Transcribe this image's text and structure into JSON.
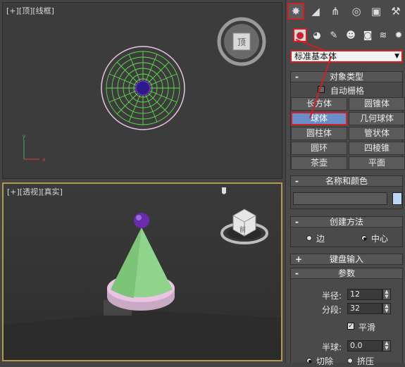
{
  "viewport_top": {
    "label": "[+][顶][线框]"
  },
  "viewport_persp": {
    "label": "[+][透视][真实]"
  },
  "viewcube_top": {
    "face": "顶"
  },
  "viewcube_persp": {
    "face": "前"
  },
  "panel": {
    "tabs": [
      {
        "icon": "create-icon",
        "glyph": "✸",
        "selected": true
      },
      {
        "icon": "modify-icon",
        "glyph": "◢",
        "selected": false
      },
      {
        "icon": "hierarchy-icon",
        "glyph": "⋔",
        "selected": false
      },
      {
        "icon": "motion-icon",
        "glyph": "◎",
        "selected": false
      },
      {
        "icon": "display-icon",
        "glyph": "▣",
        "selected": false
      },
      {
        "icon": "utilities-icon",
        "glyph": "⚒",
        "selected": false
      }
    ],
    "subtabs": [
      {
        "icon": "geometry-icon",
        "glyph": "●",
        "selected": true
      },
      {
        "icon": "shapes-icon",
        "glyph": "◕",
        "selected": false
      },
      {
        "icon": "lights-icon",
        "glyph": "✎",
        "selected": false
      },
      {
        "icon": "cameras-icon",
        "glyph": "☻",
        "selected": false
      },
      {
        "icon": "helpers-icon",
        "glyph": "◙",
        "selected": false
      },
      {
        "icon": "spacewarps-icon",
        "glyph": "≋",
        "selected": false
      },
      {
        "icon": "systems-icon",
        "glyph": "✹",
        "selected": false
      }
    ],
    "dropdown": {
      "value": "标准基本体",
      "arrow": "▼"
    },
    "object_type": {
      "title": "对象类型",
      "sign": "-",
      "autogrid": "自动栅格",
      "buttons": [
        "长方体",
        "圆锥体",
        "球体",
        "几何球体",
        "圆柱体",
        "管状体",
        "圆环",
        "四棱锥",
        "茶壶",
        "平面"
      ]
    },
    "name_color": {
      "title": "名称和颜色",
      "sign": "-",
      "swatch_color": "#bcd6f7"
    },
    "creation_method": {
      "title": "创建方法",
      "sign": "-",
      "edge": "边",
      "center": "中心"
    },
    "keyboard_entry": {
      "title": "键盘输入",
      "sign": "+"
    },
    "parameters": {
      "title": "参数",
      "sign": "-",
      "radius_label": "半径:",
      "radius_value": "12",
      "segments_label": "分段:",
      "segments_value": "32",
      "smooth_label": "平滑",
      "hemisphere_label": "半球:",
      "hemisphere_value": "0.0",
      "chop_label": "切除",
      "squash_label": "挤压"
    }
  },
  "colors": {
    "highlight": "#d21f1f",
    "active_button": "#6a8fc8",
    "wire_green": "#5edc4c",
    "cone_green": "#8fd48a",
    "base_pink": "#e9c4e3",
    "sphere_purple": "#6b2bb0"
  }
}
